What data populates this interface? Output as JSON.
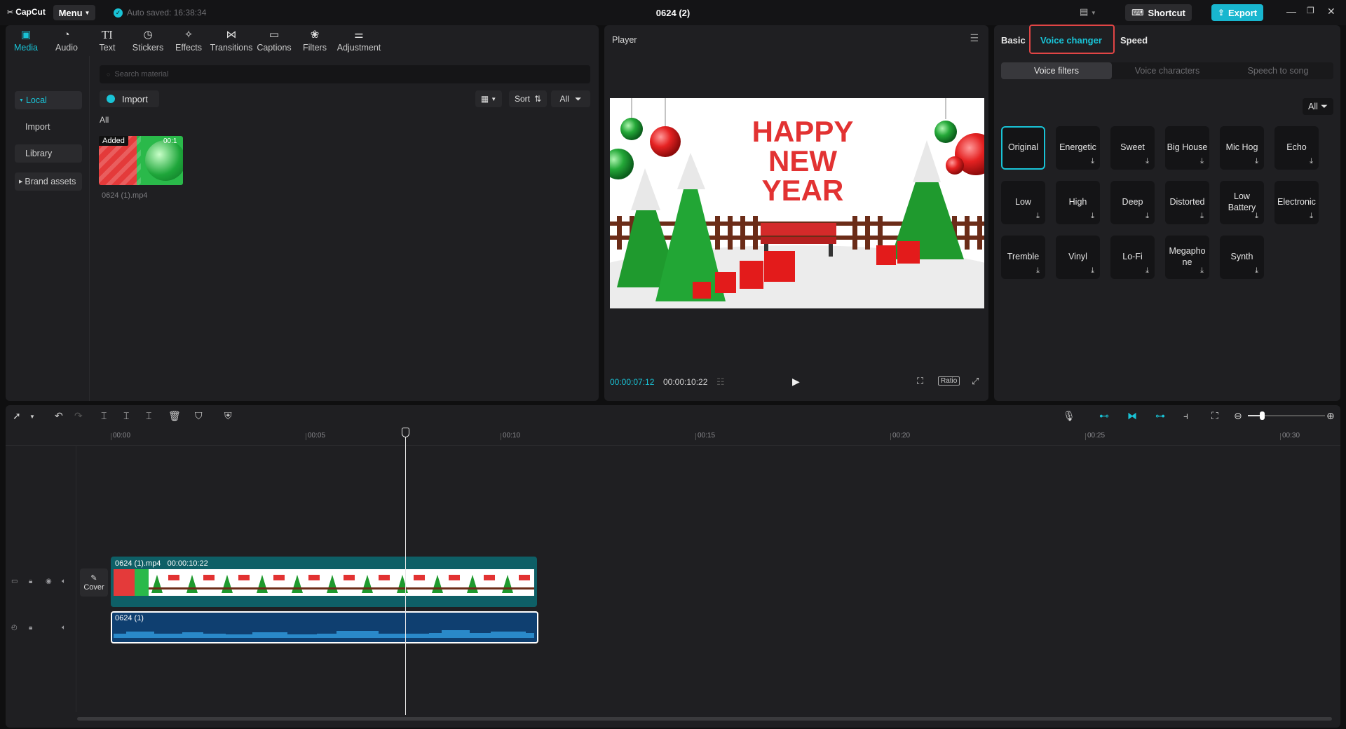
{
  "app": {
    "logo_text": "CapCut",
    "menu_label": "Menu",
    "autosave_text": "Auto saved: 16:38:34",
    "project_title": "0624 (2)",
    "shortcut_label": "Shortcut",
    "export_label": "Export",
    "accent": "#19c3d6"
  },
  "media_toolbar": [
    {
      "label": "Media",
      "icon": "media-icon"
    },
    {
      "label": "Audio",
      "icon": "audio-icon"
    },
    {
      "label": "Text",
      "icon": "text-icon"
    },
    {
      "label": "Stickers",
      "icon": "sticker-icon"
    },
    {
      "label": "Effects",
      "icon": "effects-icon"
    },
    {
      "label": "Transitions",
      "icon": "transitions-icon"
    },
    {
      "label": "Captions",
      "icon": "captions-icon"
    },
    {
      "label": "Filters",
      "icon": "filters-icon"
    },
    {
      "label": "Adjustment",
      "icon": "adjustment-icon"
    }
  ],
  "media_sidebar": {
    "local": "Local",
    "import": "Import",
    "library": "Library",
    "brand_assets": "Brand assets"
  },
  "media": {
    "search_placeholder": "Search material",
    "import_label": "Import",
    "sort_label": "Sort",
    "all_label": "All",
    "section_label": "All",
    "items": [
      {
        "badge": "Added",
        "duration": "00:1",
        "name": "0624 (1).mp4"
      }
    ]
  },
  "player": {
    "title": "Player",
    "current_time": "00:00:07:12",
    "total_time": "00:00:10:22",
    "ratio_label": "Ratio",
    "frame_text": [
      "HAPPY",
      "NEW",
      "YEAR"
    ]
  },
  "right_panel": {
    "tabs": [
      "Basic",
      "Voice changer",
      "Speed"
    ],
    "active_tab": "Voice changer",
    "subtabs": [
      "Voice filters",
      "Voice characters",
      "Speech to song"
    ],
    "active_subtab": "Voice filters",
    "filter_all": "All",
    "voice_filters": [
      {
        "label": "Original"
      },
      {
        "label": "Energetic"
      },
      {
        "label": "Sweet"
      },
      {
        "label": "Big House"
      },
      {
        "label": "Mic Hog"
      },
      {
        "label": "Echo"
      },
      {
        "label": "Low"
      },
      {
        "label": "High"
      },
      {
        "label": "Deep"
      },
      {
        "label": "Distorted"
      },
      {
        "label": "Low Battery"
      },
      {
        "label": "Electronic"
      },
      {
        "label": "Tremble"
      },
      {
        "label": "Vinyl"
      },
      {
        "label": "Lo-Fi"
      },
      {
        "label": "Megaphone"
      },
      {
        "label": "Synth"
      }
    ]
  },
  "timeline": {
    "ruler": [
      "00:00",
      "00:05",
      "00:10",
      "00:15",
      "00:20",
      "00:25",
      "00:30"
    ],
    "cover_label": "Cover",
    "video_clip": {
      "name": "0624 (1).mp4",
      "duration": "00:00:10:22"
    },
    "audio_clip": {
      "name": "0624 (1)"
    }
  }
}
